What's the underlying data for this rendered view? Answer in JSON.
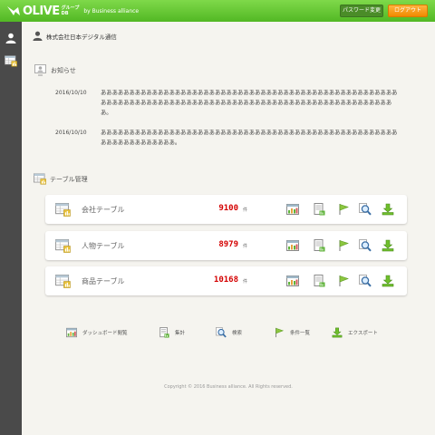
{
  "header": {
    "logo_text": "OLIVE",
    "logo_sub_top": "グループ",
    "logo_sub_bottom": "DB",
    "logo_by": "by Business alliance",
    "password_button": "パスワード変更",
    "logout_button": "ログアウト"
  },
  "sidebar": {
    "items": [
      {
        "icon": "user-icon"
      },
      {
        "icon": "table-icon"
      }
    ]
  },
  "company": {
    "name": "株式会社日本デジタル通信"
  },
  "news": {
    "title": "お知らせ",
    "items": [
      {
        "date": "2016/10/10",
        "text": "ああああああああああああああああああああああああああああああああああああああああああああああああああああああああああああああああああああああああああああああああああああああああああああああああああああああああ。"
      },
      {
        "date": "2016/10/10",
        "text": "あああああああああああああああああああああああああああああああああああああああああああああああああああああああああああああああああ。"
      }
    ]
  },
  "tables": {
    "title": "テーブル管理",
    "unit": "件",
    "items": [
      {
        "name": "会社テーブル",
        "count": "9100"
      },
      {
        "name": "人物テーブル",
        "count": "8979"
      },
      {
        "name": "商品テーブル",
        "count": "10168"
      }
    ]
  },
  "legend": {
    "dashboard": "ダッシュボード閲覧",
    "aggregate": "集計",
    "search": "検索",
    "conditions": "条件一覧",
    "export": "エクスポート"
  },
  "footer": {
    "copyright": "Copyright © 2016 Business alliance. All Rights reserved."
  },
  "colors": {
    "header_green": "#5cc02c",
    "logout_orange": "#f7a11a",
    "count_red": "#d40000",
    "sidebar": "#4a4a4a"
  }
}
